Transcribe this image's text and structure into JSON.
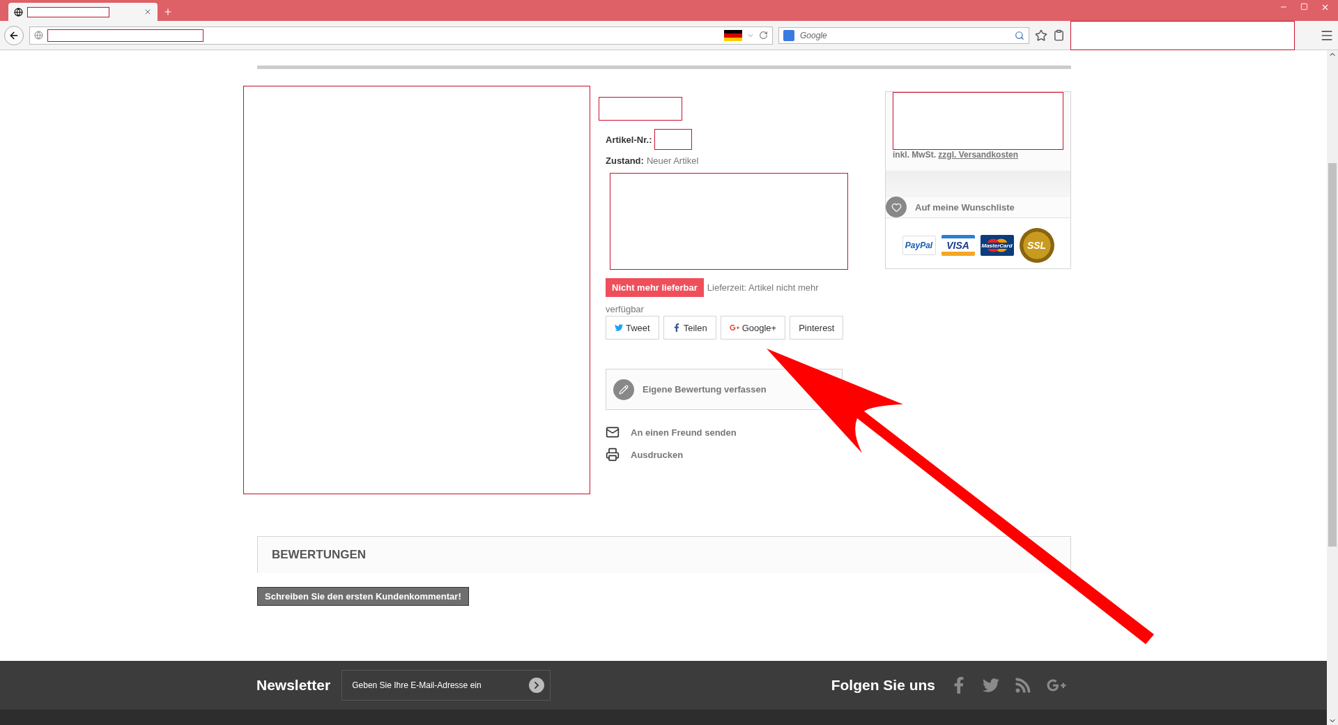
{
  "browser": {
    "search_placeholder": "Google"
  },
  "product": {
    "article_label": "Artikel-Nr.:",
    "condition_label": "Zustand:",
    "condition": "Neuer Artikel",
    "availability": "Nicht mehr lieferbar",
    "delivery": "Lieferzeit: Artikel nicht mehr",
    "delivery_continued": "verfügbar",
    "share_buttons": [
      {
        "kind": "twitter",
        "label": "Tweet"
      },
      {
        "kind": "facebook",
        "label": "Teilen"
      },
      {
        "kind": "google",
        "label": "Google+"
      },
      {
        "kind": "pinterest",
        "label": "Pinterest"
      }
    ],
    "review_prompt": "Eigene Bewertung verfassen",
    "links": [
      {
        "kind": "mail",
        "label": "An einen Freund senden"
      },
      {
        "kind": "print",
        "label": "Ausdrucken"
      }
    ]
  },
  "price_box": {
    "tax_note": "inkl. MwSt.",
    "shipping_link": "zzgl. Versandkosten",
    "wishlist": "Auf meine Wunschliste",
    "payment_logos": [
      {
        "kind": "paypal",
        "label": "PayPal"
      },
      {
        "kind": "visa",
        "label": "VISA"
      },
      {
        "kind": "mastercard",
        "label": "MasterCard"
      },
      {
        "kind": "ssl",
        "label": "SSL"
      }
    ]
  },
  "reviews": {
    "title": "BEWERTUNGEN",
    "button": "Schreiben Sie den ersten Kundenkommentar!"
  },
  "footer": {
    "newsletter_title": "Newsletter",
    "newsletter_placeholder": "Geben Sie Ihre E-Mail-Adresse ein",
    "follow_title": "Folgen Sie uns",
    "social": [
      {
        "kind": "facebook"
      },
      {
        "kind": "twitter"
      },
      {
        "kind": "rss"
      },
      {
        "kind": "google"
      }
    ]
  }
}
